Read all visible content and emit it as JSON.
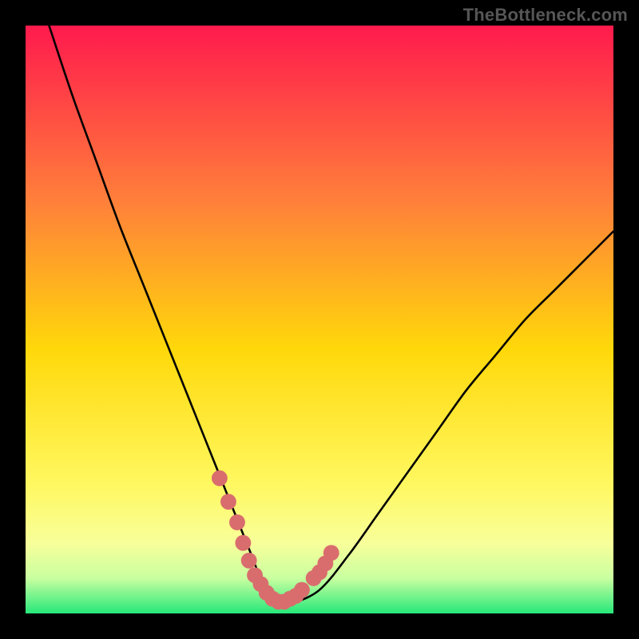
{
  "watermark": "TheBottleneck.com",
  "colors": {
    "frame": "#000000",
    "gradient_top": "#ff1a4d",
    "gradient_upper_mid": "#ff803a",
    "gradient_mid": "#ffd80a",
    "gradient_lower_mid": "#fff860",
    "gradient_low": "#f8ff9a",
    "gradient_near_bottom": "#c9ffa0",
    "gradient_bottom": "#26e87a",
    "curve": "#000000",
    "marker": "#d96d6d"
  },
  "chart_data": {
    "type": "line",
    "title": "",
    "xlabel": "",
    "ylabel": "",
    "xlim": [
      0,
      100
    ],
    "ylim": [
      0,
      100
    ],
    "series": [
      {
        "name": "bottleneck-curve",
        "x": [
          4,
          8,
          12,
          16,
          20,
          24,
          28,
          32,
          34,
          36,
          38,
          40,
          42,
          43,
          44,
          45,
          50,
          55,
          60,
          65,
          70,
          75,
          80,
          85,
          90,
          95,
          100
        ],
        "y": [
          100,
          88,
          77,
          66,
          56,
          46,
          36,
          26,
          21,
          16,
          11,
          6,
          3,
          1.5,
          1,
          1.5,
          4,
          10,
          17,
          24,
          31,
          38,
          44,
          50,
          55,
          60,
          65
        ]
      }
    ],
    "annotations": [
      {
        "name": "marker-cluster-left",
        "points_xy": [
          [
            33,
            23
          ],
          [
            34.5,
            19
          ],
          [
            36,
            15.5
          ],
          [
            37,
            12
          ],
          [
            38,
            9
          ],
          [
            39,
            6.5
          ],
          [
            40,
            5
          ]
        ]
      },
      {
        "name": "marker-cluster-bottom",
        "points_xy": [
          [
            41,
            3.5
          ],
          [
            42,
            2.5
          ],
          [
            43,
            2
          ],
          [
            44,
            2
          ],
          [
            45,
            2.5
          ],
          [
            46,
            3
          ],
          [
            47,
            4
          ]
        ]
      },
      {
        "name": "marker-cluster-right",
        "points_xy": [
          [
            49,
            6
          ],
          [
            50,
            7
          ],
          [
            51,
            8.5
          ],
          [
            52,
            10.3
          ]
        ]
      }
    ]
  }
}
